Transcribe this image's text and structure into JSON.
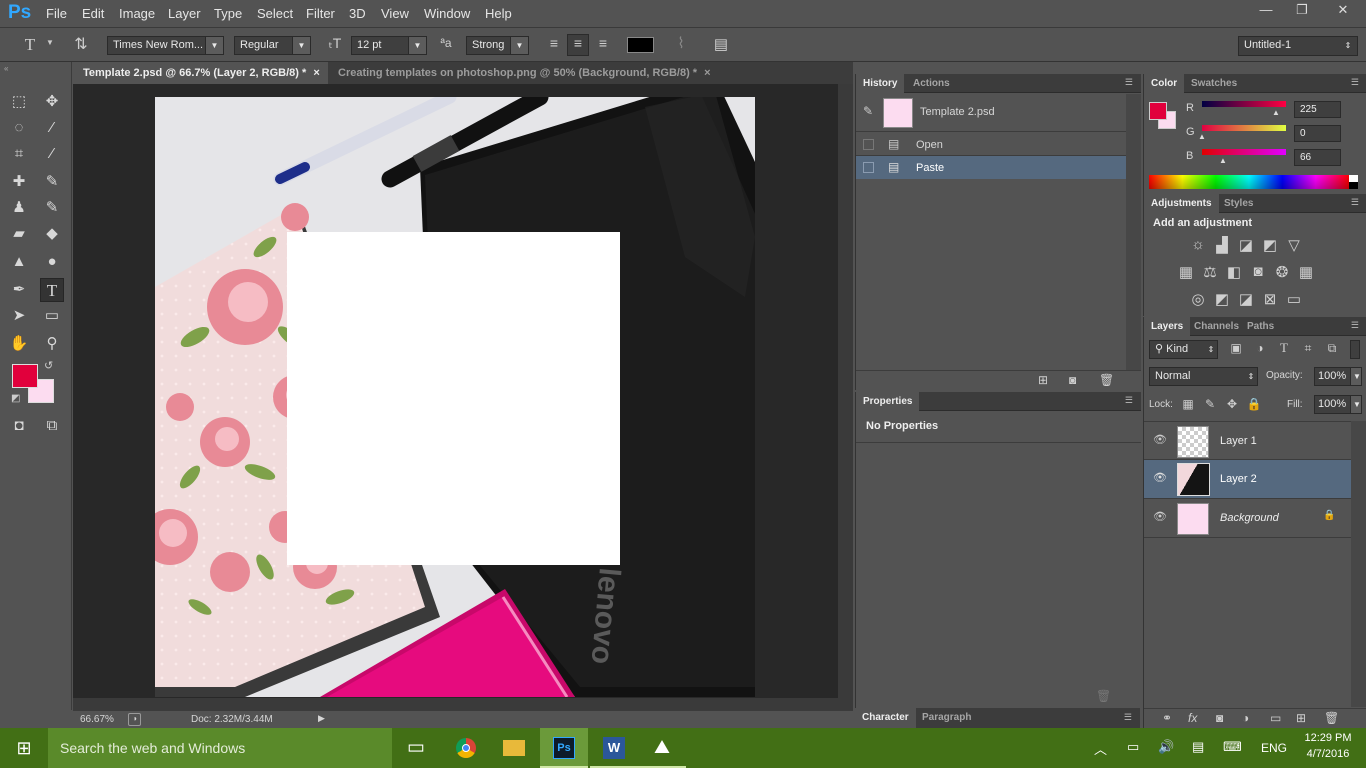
{
  "app": {
    "logo": "Ps"
  },
  "menu": [
    "File",
    "Edit",
    "Image",
    "Layer",
    "Type",
    "Select",
    "Filter",
    "3D",
    "View",
    "Window",
    "Help"
  ],
  "window_buttons": {
    "minimize": "—",
    "restore": "❐",
    "close": "✕"
  },
  "options_bar": {
    "tool_glyph": "T",
    "font_family": "Times New Rom...",
    "font_style": "Regular",
    "font_size": "12 pt",
    "aa_label": "ªa",
    "antialias": "Strong",
    "text_color": "#000000",
    "workspace": "Untitled-1"
  },
  "document_tabs": [
    {
      "label": "Template 2.psd @ 66.7% (Layer 2, RGB/8) *",
      "active": true
    },
    {
      "label": "Creating templates on photoshop.png @ 50% (Background, RGB/8) *",
      "active": false
    }
  ],
  "tab_close": "×",
  "foreground_color": "#e1003c",
  "background_color": "#fcdcf0",
  "canvas": {
    "placeholder_fill": "#ffffff",
    "notebook_color": "#e60b7e",
    "laptop_logo": "lenovo"
  },
  "status": {
    "zoom": "66.67%",
    "doc": "Doc: 2.32M/3.44M"
  },
  "history": {
    "tabs": [
      "History",
      "Actions"
    ],
    "snapshot": "Template 2.psd",
    "states": [
      {
        "label": "Open"
      },
      {
        "label": "Paste",
        "selected": true
      }
    ]
  },
  "properties": {
    "tab": "Properties",
    "content": "No Properties"
  },
  "character_tabs": [
    "Character",
    "Paragraph"
  ],
  "color_panel": {
    "tabs": [
      "Color",
      "Swatches"
    ],
    "channels": [
      {
        "label": "R",
        "value": "225"
      },
      {
        "label": "G",
        "value": "0"
      },
      {
        "label": "B",
        "value": "66"
      }
    ]
  },
  "adjustments": {
    "tabs": [
      "Adjustments",
      "Styles"
    ],
    "title": "Add an adjustment"
  },
  "layers": {
    "tabs": [
      "Layers",
      "Channels",
      "Paths"
    ],
    "filter_kind": "Kind",
    "blend_mode": "Normal",
    "opacity_label": "Opacity:",
    "opacity": "100%",
    "lock_label": "Lock:",
    "fill_label": "Fill:",
    "fill": "100%",
    "items": [
      {
        "name": "Layer 1",
        "selected": false
      },
      {
        "name": "Layer 2",
        "selected": true
      },
      {
        "name": "Background",
        "selected": false,
        "locked": true
      }
    ]
  },
  "taskbar": {
    "search_placeholder": "Search the web and Windows",
    "lang": "ENG",
    "time": "12:29 PM",
    "date": "4/7/2016",
    "accent": "#426f15"
  }
}
